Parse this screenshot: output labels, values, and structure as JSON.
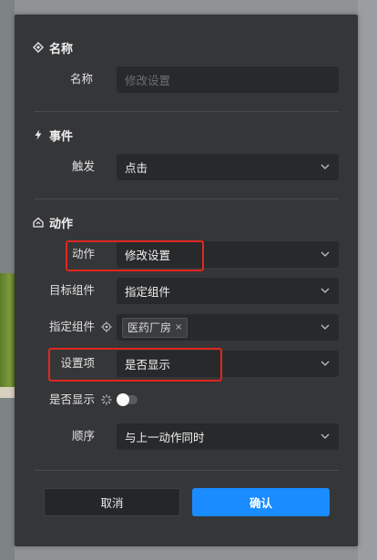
{
  "sections": {
    "name": {
      "title": "名称"
    },
    "event": {
      "title": "事件"
    },
    "action": {
      "title": "动作"
    }
  },
  "fields": {
    "name": {
      "label": "名称",
      "placeholder": "修改设置"
    },
    "trigger": {
      "label": "触发",
      "value": "点击"
    },
    "action": {
      "label": "动作",
      "value": "修改设置"
    },
    "target_component": {
      "label": "目标组件",
      "value": "指定组件"
    },
    "specified_component": {
      "label": "指定组件",
      "tag": "医药厂房",
      "tag_close": "×"
    },
    "setting_item": {
      "label": "设置项",
      "value": "是否显示"
    },
    "is_visible": {
      "label": "是否显示",
      "on": false
    },
    "order": {
      "label": "顺序",
      "value": "与上一动作同时"
    }
  },
  "buttons": {
    "cancel": "取消",
    "confirm": "确认"
  },
  "colors": {
    "panel": "#353638",
    "field": "#28292b",
    "primary": "#1a8cff",
    "highlight": "#e0261f"
  }
}
